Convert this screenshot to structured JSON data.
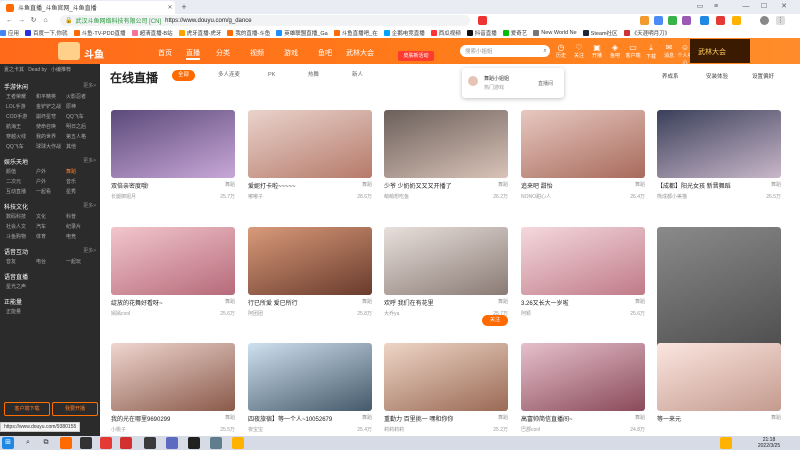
{
  "browser": {
    "tab_title": "斗鱼直播_斗鱼官网_斗鱼直播",
    "owner": "武汉斗鱼网络科技有限公司 [CN]",
    "url": "https://www.douyu.com/g_dance",
    "status_url": "https://www.douyu.com/9380155"
  },
  "bookmarks": [
    "应用",
    "百度一下,你就",
    "斗鱼-TV-PDD直播",
    "超清直播-B站",
    "虎牙直播-虎牙",
    "我的直播-斗鱼",
    "英雄联盟直播_Ga",
    "斗鱼直播吧_在",
    "企鹅电竞直播",
    "西瓜视频",
    "抖音直播",
    "爱奇艺",
    "New World Ne",
    "Steam社区",
    "《天涯明月刀》"
  ],
  "header": {
    "logo": "斗鱼",
    "nav": [
      "首页",
      "直播",
      "分类",
      "视频",
      "游戏",
      "鱼吧",
      "武林大会"
    ],
    "active_nav": 1,
    "banner": "皮肤新活动",
    "search_placeholder": "搜索小姐姐",
    "icons": [
      "历史",
      "关注",
      "开播",
      "鱼吧",
      "客户端",
      "下载",
      "消息",
      "个人中心"
    ],
    "promo": "武林大会"
  },
  "sidebar": {
    "top_line": [
      "夏之卡其",
      "Dead by",
      "小编推荐"
    ],
    "sections": [
      {
        "title": "手游休闲",
        "more": "更多>",
        "items": [
          "王者荣耀",
          "和平精英",
          "火影忍者",
          "LOL手游",
          "金铲铲之战",
          "原神",
          "COD手游",
          "崩坏星穹",
          "QQ飞车",
          "航海王",
          "使命召唤",
          "明日之后",
          "穿越火线",
          "我的世界",
          "第五人格",
          "QQ飞车",
          "球球大作战",
          "其他"
        ]
      },
      {
        "title": "娱乐天地",
        "more": "更多>",
        "items": [
          "颜值",
          "户外",
          "舞蹈",
          "二次元",
          "户外",
          "音乐",
          "互动直播",
          "一起看",
          "星秀"
        ]
      },
      {
        "title": "科技文化",
        "more": "更多>",
        "items": [
          "数码科技",
          "文化",
          "科普",
          "社会人文",
          "汽车",
          "纪录片",
          "斗鱼购物",
          "体育",
          "电竞"
        ]
      },
      {
        "title": "语音互动",
        "more": "更多>",
        "items": [
          "音友",
          "电台",
          "一起玩"
        ]
      },
      {
        "title": "语音直播",
        "more": "",
        "items": [
          "星光之声"
        ]
      },
      {
        "title": "正能量",
        "more": "",
        "items": [
          "正能量"
        ]
      }
    ],
    "highlight": "舞蹈",
    "buttons": [
      "客户端下载",
      "我要开播"
    ]
  },
  "main": {
    "title": "在线直播",
    "chips": [
      "全部",
      "多人连麦",
      "PK",
      "热舞",
      "新人"
    ],
    "right_links": [
      "养成系",
      "安装体验",
      "设置偏好"
    ],
    "popup": {
      "name": "舞蹈小姐姐",
      "sub": "热门游戏",
      "tag": "直播间"
    },
    "cards": [
      {
        "title": "双倍亲密度哦!",
        "cat": "舞蹈",
        "user": "长腿御姐月",
        "count": "25.7万"
      },
      {
        "title": "爱妮打卡啦~~~~~",
        "cat": "舞蹈",
        "user": "嘟嘟子",
        "count": "28.6万"
      },
      {
        "title": "少爷 少奶奶又又又开播了",
        "cat": "舞蹈",
        "user": "萌萌想吃鱼",
        "count": "26.2万"
      },
      {
        "title": "追来吧 甜怡",
        "cat": "舞蹈",
        "user": "NONO甜心人",
        "count": "26.4万"
      },
      {
        "title": "【成都】阳光女孩 新晋舞蹈",
        "cat": "舞蹈",
        "user": "熊成都小美猫",
        "count": "26.5万"
      },
      {
        "title": "绽放的花舞好看呀~",
        "cat": "舞蹈",
        "user": "嫣嫣cool",
        "count": "25.6万"
      },
      {
        "title": "行已所爱 爱已所行",
        "cat": "舞蹈",
        "user": "阿团团",
        "count": "25.8万"
      },
      {
        "title": "欢呼 我们在有花里",
        "cat": "舞蹈",
        "user": "大乔ya",
        "count": "25.7万"
      },
      {
        "title": "3.26又长大一岁啦",
        "cat": "舞蹈",
        "user": "阿颖",
        "count": "25.6万"
      },
      {
        "title": "",
        "cat": "",
        "user": "",
        "count": ""
      },
      {
        "title": "我的光在哪里9690299",
        "cat": "舞蹈",
        "user": "小桃子",
        "count": "25.5万"
      },
      {
        "title": "四夜旅宿】等一个人~10052679",
        "cat": "舞蹈",
        "user": "夜宝宝",
        "count": "25.4万"
      },
      {
        "title": "重勤力 百里挑一 嘿和你你",
        "cat": "舞蹈",
        "user": "莉莉莉莉",
        "count": "25.2万"
      },
      {
        "title": "高富帅简信直播间~",
        "cat": "舞蹈",
        "user": "巴郡cool",
        "count": "24.8万"
      },
      {
        "title": "等一来元",
        "cat": "舞蹈",
        "user": "",
        "count": ""
      }
    ],
    "hover_follow": "关注"
  },
  "taskbar": {
    "time": "21:18",
    "date": "2022/3/25"
  },
  "colors": {
    "accent": "#ff6a00",
    "sidebar": "#2b2b2b"
  }
}
